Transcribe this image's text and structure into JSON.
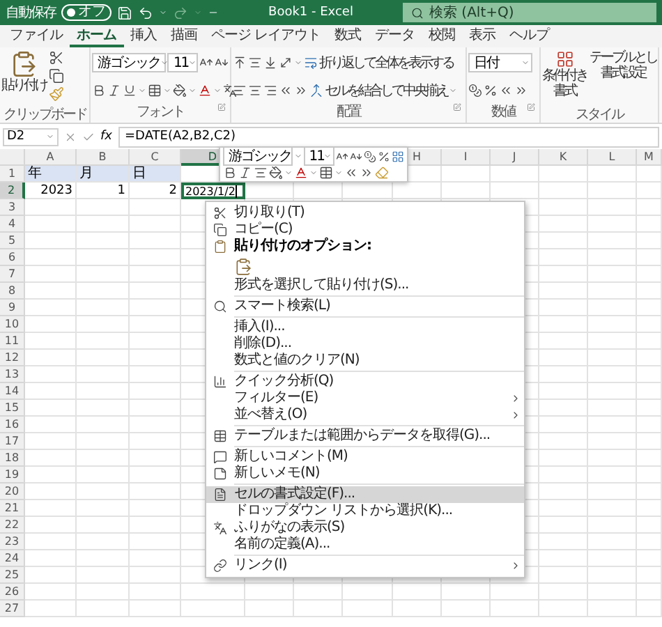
{
  "title_bar": {
    "autosave_label": "自動保存",
    "autosave_toggle": {
      "label": "オフ",
      "on": false
    },
    "title": "Book1 - Excel",
    "search": {
      "placeholder": "検索 (Alt+Q)"
    }
  },
  "tabs": [
    {
      "label": "ファイル",
      "selected": false
    },
    {
      "label": "ホーム",
      "selected": true
    },
    {
      "label": "挿入",
      "selected": false
    },
    {
      "label": "描画",
      "selected": false
    },
    {
      "label": "ページ レイアウト",
      "selected": false
    },
    {
      "label": "数式",
      "selected": false
    },
    {
      "label": "データ",
      "selected": false
    },
    {
      "label": "校閲",
      "selected": false
    },
    {
      "label": "表示",
      "selected": false
    },
    {
      "label": "ヘルプ",
      "selected": false
    }
  ],
  "ribbon": {
    "clipboard": {
      "paste": "貼り付け",
      "group_label": "クリップボード"
    },
    "font": {
      "font_name": "游ゴシック",
      "font_size": "11",
      "group_label": "フォント"
    },
    "alignment": {
      "wrap_text": "折り返して全体を表示する",
      "merge": "セルを結合して中央揃え",
      "group_label": "配置"
    },
    "number": {
      "format": "日付",
      "group_label": "数値"
    },
    "styles": {
      "conditional": [
        "条件付き",
        "書式"
      ],
      "table": [
        "テーブルとし",
        "書式設定"
      ],
      "group_label": "スタイル"
    }
  },
  "formula_bar": {
    "name_box": "D2",
    "fx": "fx",
    "formula": "=DATE(A2,B2,C2)"
  },
  "sheet": {
    "columns_left": [
      {
        "label": "A",
        "selected": false
      },
      {
        "label": "B",
        "selected": false
      },
      {
        "label": "C",
        "selected": false
      },
      {
        "label": "D",
        "selected": true
      }
    ],
    "columns_right": [
      {
        "label": "H",
        "selected": false
      },
      {
        "label": "I",
        "selected": false
      },
      {
        "label": "J",
        "selected": false
      },
      {
        "label": "K",
        "selected": false
      },
      {
        "label": "L",
        "selected": false
      },
      {
        "label": "M",
        "selected": false
      }
    ],
    "rows": [
      {
        "number": "1",
        "selected": false,
        "cells": [
          {
            "kind": "label",
            "text": "年"
          },
          {
            "kind": "label",
            "text": "月"
          },
          {
            "kind": "label",
            "text": "日"
          }
        ]
      },
      {
        "number": "2",
        "selected": true,
        "cells": [
          {
            "kind": "number",
            "text": "2023"
          },
          {
            "kind": "number",
            "text": "1"
          },
          {
            "kind": "number",
            "text": "2"
          },
          {
            "kind": "editing",
            "text": "2023/1/2"
          }
        ]
      },
      {
        "number": "3",
        "selected": false
      },
      {
        "number": "4",
        "selected": false
      },
      {
        "number": "5",
        "selected": false
      },
      {
        "number": "6",
        "selected": false
      },
      {
        "number": "7",
        "selected": false
      },
      {
        "number": "8",
        "selected": false
      },
      {
        "number": "9",
        "selected": false
      },
      {
        "number": "10",
        "selected": false
      },
      {
        "number": "11",
        "selected": false
      },
      {
        "number": "12",
        "selected": false
      },
      {
        "number": "13",
        "selected": false
      },
      {
        "number": "14",
        "selected": false
      },
      {
        "number": "15",
        "selected": false
      },
      {
        "number": "16",
        "selected": false
      },
      {
        "number": "17",
        "selected": false
      },
      {
        "number": "18",
        "selected": false
      },
      {
        "number": "19",
        "selected": false
      },
      {
        "number": "20",
        "selected": false
      },
      {
        "number": "21",
        "selected": false
      },
      {
        "number": "22",
        "selected": false
      },
      {
        "number": "23",
        "selected": false
      },
      {
        "number": "24",
        "selected": false
      },
      {
        "number": "25",
        "selected": false
      },
      {
        "number": "26",
        "selected": false
      },
      {
        "number": "27",
        "selected": false
      }
    ]
  },
  "mini_toolbar": {
    "font_name": "游ゴシック",
    "font_size": "11"
  },
  "context_menu": [
    {
      "kind": "item",
      "label": "切り取り(T)",
      "submenu": false,
      "selected": false
    },
    {
      "kind": "item",
      "label": "コピー(C)",
      "submenu": false,
      "selected": false
    },
    {
      "kind": "header",
      "label": "貼り付けのオプション:"
    },
    {
      "kind": "paste"
    },
    {
      "kind": "item",
      "label": "形式を選択して貼り付け(S)...",
      "submenu": false,
      "selected": false
    },
    {
      "kind": "separator"
    },
    {
      "kind": "item",
      "label": "スマート検索(L)",
      "submenu": false,
      "selected": false
    },
    {
      "kind": "separator"
    },
    {
      "kind": "item",
      "label": "挿入(I)...",
      "submenu": false,
      "selected": false
    },
    {
      "kind": "item",
      "label": "削除(D)...",
      "submenu": false,
      "selected": false
    },
    {
      "kind": "item",
      "label": "数式と値のクリア(N)",
      "submenu": false,
      "selected": false
    },
    {
      "kind": "separator"
    },
    {
      "kind": "item",
      "label": "クイック分析(Q)",
      "submenu": false,
      "selected": false
    },
    {
      "kind": "item",
      "label": "フィルター(E)",
      "submenu": true,
      "selected": false
    },
    {
      "kind": "item",
      "label": "並べ替え(O)",
      "submenu": true,
      "selected": false
    },
    {
      "kind": "separator"
    },
    {
      "kind": "item",
      "label": "テーブルまたは範囲からデータを取得(G)...",
      "submenu": false,
      "selected": false
    },
    {
      "kind": "separator"
    },
    {
      "kind": "item",
      "label": "新しいコメント(M)",
      "submenu": false,
      "selected": false
    },
    {
      "kind": "item",
      "label": "新しいメモ(N)",
      "submenu": false,
      "selected": false
    },
    {
      "kind": "separator"
    },
    {
      "kind": "item",
      "label": "セルの書式設定(F)...",
      "submenu": false,
      "selected": true
    },
    {
      "kind": "item",
      "label": "ドロップダウン リストから選択(K)...",
      "submenu": false,
      "selected": false
    },
    {
      "kind": "item",
      "label": "ふりがなの表示(S)",
      "submenu": false,
      "selected": false
    },
    {
      "kind": "item",
      "label": "名前の定義(A)...",
      "submenu": false,
      "selected": false
    },
    {
      "kind": "separator"
    },
    {
      "kind": "item",
      "label": "リンク(I)",
      "submenu": true,
      "selected": false
    }
  ]
}
